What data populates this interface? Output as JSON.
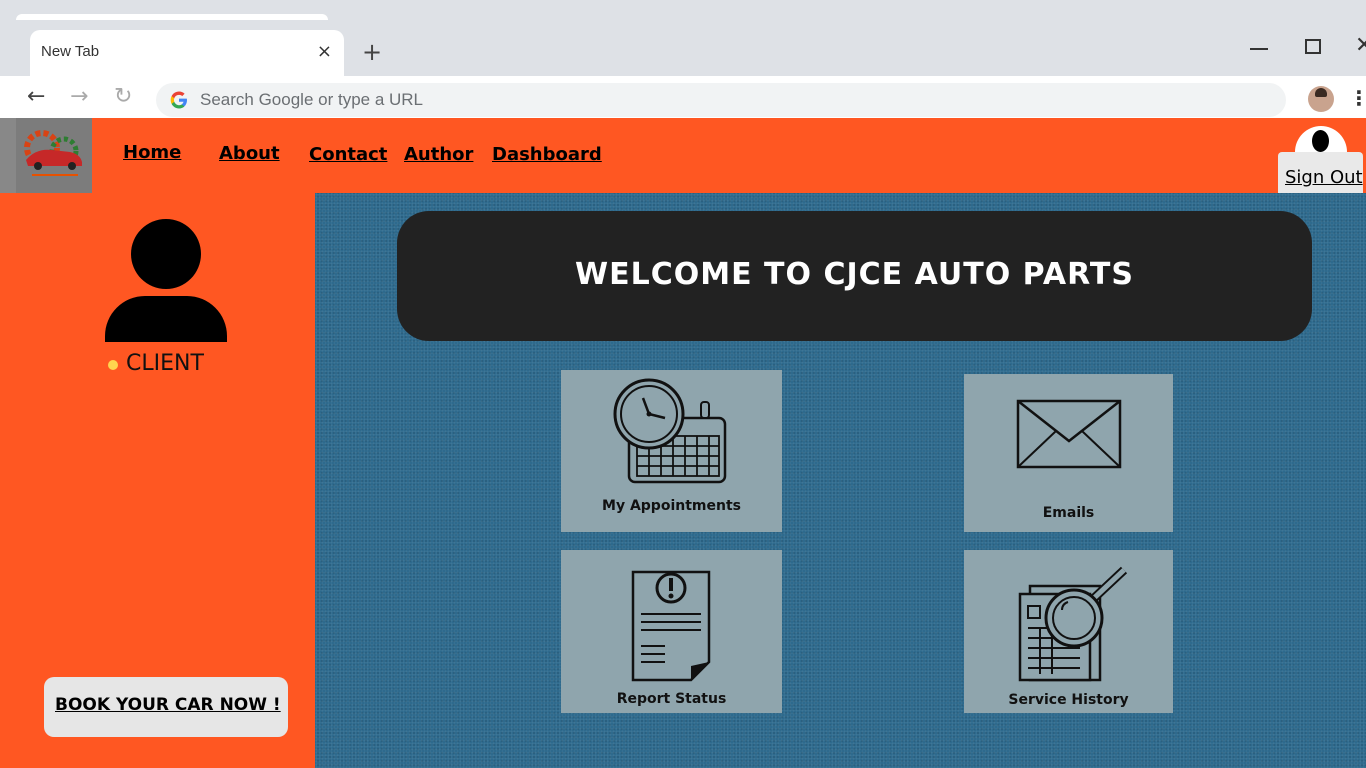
{
  "browser": {
    "tab_title": "New Tab",
    "tab_close": "×",
    "new_tab": "+",
    "omnibox_placeholder": "Search Google or type a URL",
    "back": "←",
    "forward": "→",
    "reload": "↻",
    "menu": "⋮"
  },
  "header": {
    "nav": [
      "Home",
      "About",
      "Contact",
      "Author",
      "Dashboard"
    ],
    "signout_label": "Sign Out"
  },
  "sidebar": {
    "role": "CLIENT",
    "book_button": "BOOK YOUR CAR NOW !"
  },
  "main": {
    "welcome": "WELCOME TO CJCE AUTO PARTS",
    "cards": [
      {
        "label": "My Appointments",
        "icon": "clock-calendar-icon"
      },
      {
        "label": "Emails",
        "icon": "envelope-icon"
      },
      {
        "label": "Report Status",
        "icon": "report-document-icon"
      },
      {
        "label": "Service History",
        "icon": "magnifier-document-icon"
      }
    ]
  },
  "colors": {
    "accent": "#ff5722",
    "main_bg": "#2e6a8d",
    "card_bg": "#8fa5ad",
    "welcome_bg": "#222222"
  }
}
